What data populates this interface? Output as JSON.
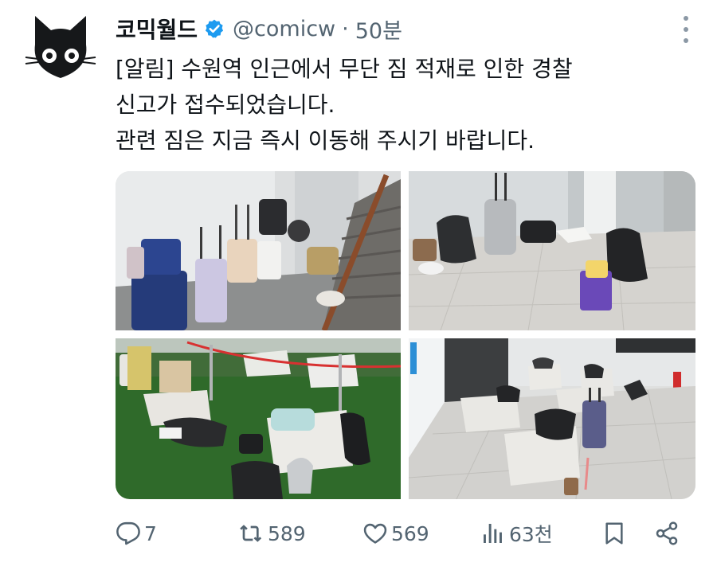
{
  "author": {
    "name": "코믹월드",
    "handle": "@comicw",
    "separator": "·",
    "time": "50분"
  },
  "tweet": {
    "lines": [
      "[알림] 수원역 인근에서 무단 짐 적재로 인한 경찰",
      "신고가 접수되었습니다.",
      "관련 짐은 지금 즉시 이동해 주시기 바랍니다."
    ]
  },
  "media": {
    "photos": [
      {
        "scene": "stairwell-luggage"
      },
      {
        "scene": "station-floor-bags"
      },
      {
        "scene": "artificial-turf-benches"
      },
      {
        "scene": "station-concourse-benches"
      }
    ]
  },
  "actions": {
    "replies": "7",
    "retweets": "589",
    "likes": "569",
    "views": "63천"
  },
  "colors": {
    "verified": "#1d9bf0",
    "text": "#0f1419",
    "muted": "#536471"
  },
  "icons": {
    "reply": "reply-icon",
    "retweet": "retweet-icon",
    "like": "heart-icon",
    "views": "views-icon",
    "bookmark": "bookmark-icon",
    "share": "share-icon",
    "more": "more-icon",
    "verified": "verified-badge-icon"
  }
}
